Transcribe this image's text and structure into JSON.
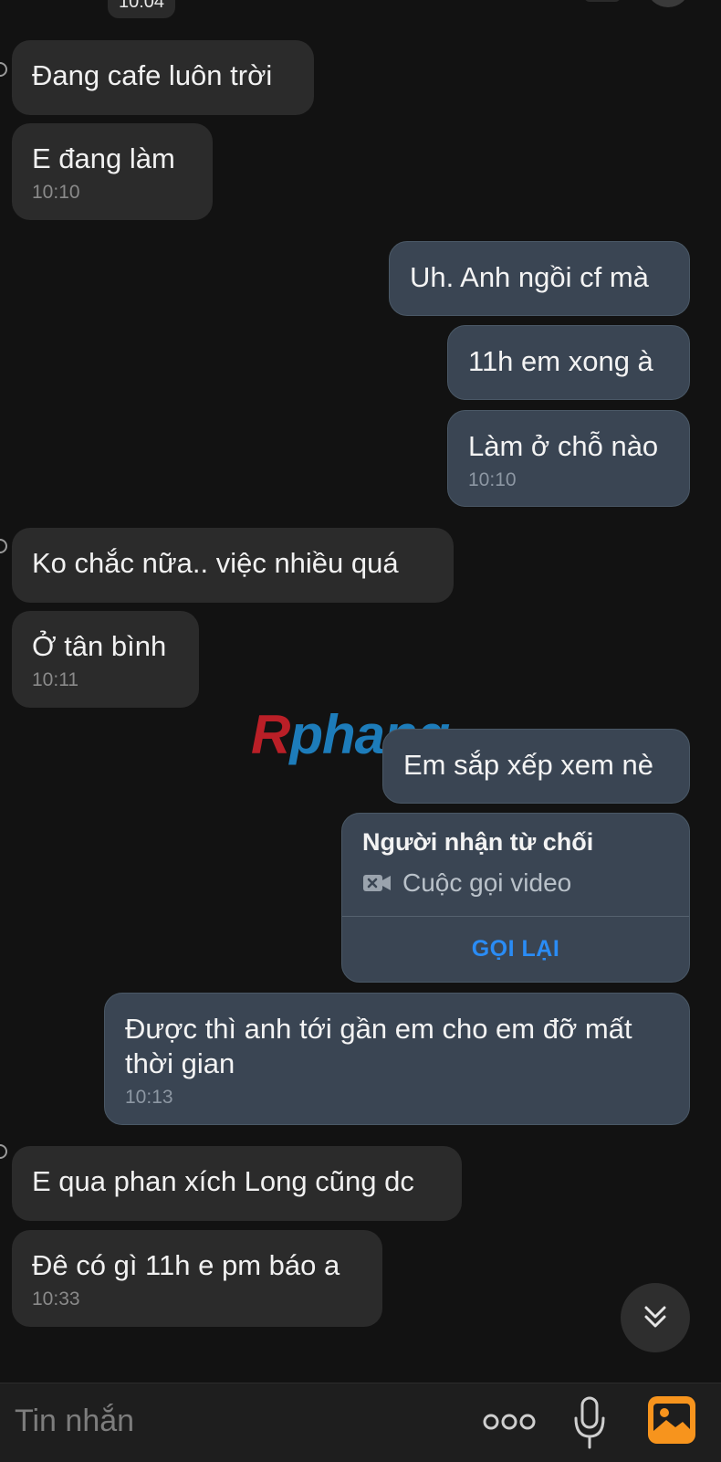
{
  "header": {
    "date_pill": "10:04"
  },
  "messages": [
    {
      "side": "in",
      "text": "Đang cafe luôn trời",
      "time": ""
    },
    {
      "side": "in",
      "text": "E đang làm",
      "time": "10:10"
    },
    {
      "side": "out",
      "text": "Uh. Anh ngồi cf mà",
      "time": ""
    },
    {
      "side": "out",
      "text": "11h em xong à",
      "time": ""
    },
    {
      "side": "out",
      "text": "Làm ở chỗ nào",
      "time": "10:10"
    },
    {
      "side": "in",
      "text": "Ko chắc nữa.. việc nhiều quá",
      "time": ""
    },
    {
      "side": "in",
      "text": "Ở tân bình",
      "time": "10:11"
    },
    {
      "side": "out",
      "text": "Em sắp xếp xem nè",
      "time": ""
    },
    {
      "side": "out",
      "text": "Được thì anh tới gần em cho em đỡ mất thời gian",
      "time": "10:13"
    },
    {
      "side": "in",
      "text": "E qua phan xích Long cũng dc",
      "time": ""
    },
    {
      "side": "in",
      "text": "Đê có gì 11h e pm báo a",
      "time": "10:33"
    }
  ],
  "call_card": {
    "title": "Người nhận từ chối",
    "subtitle": "Cuộc gọi video",
    "icon": "video-camera-off-icon",
    "action": "GỌI LẠI"
  },
  "watermark": {
    "first_letter": "R",
    "rest": "phang"
  },
  "composer": {
    "placeholder": "Tin nhắn",
    "icons": [
      "more-dots-icon",
      "microphone-icon",
      "image-gallery-icon"
    ]
  },
  "colors": {
    "background": "#121212",
    "incoming_bubble": "#2b2b2b",
    "outgoing_bubble": "#3a4553",
    "accent": "#2a8cf5",
    "gallery_icon": "#f7941d"
  }
}
